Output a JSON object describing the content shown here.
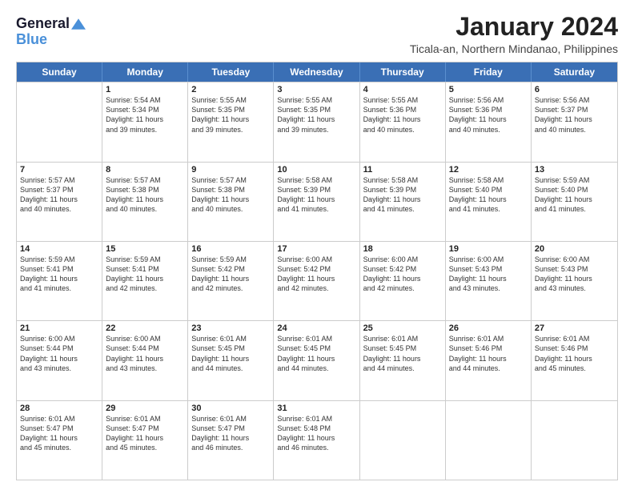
{
  "logo": {
    "line1": "General",
    "line2": "Blue"
  },
  "title": "January 2024",
  "subtitle": "Ticala-an, Northern Mindanao, Philippines",
  "header_days": [
    "Sunday",
    "Monday",
    "Tuesday",
    "Wednesday",
    "Thursday",
    "Friday",
    "Saturday"
  ],
  "weeks": [
    [
      {
        "day": "",
        "info": ""
      },
      {
        "day": "1",
        "info": "Sunrise: 5:54 AM\nSunset: 5:34 PM\nDaylight: 11 hours\nand 39 minutes."
      },
      {
        "day": "2",
        "info": "Sunrise: 5:55 AM\nSunset: 5:35 PM\nDaylight: 11 hours\nand 39 minutes."
      },
      {
        "day": "3",
        "info": "Sunrise: 5:55 AM\nSunset: 5:35 PM\nDaylight: 11 hours\nand 39 minutes."
      },
      {
        "day": "4",
        "info": "Sunrise: 5:55 AM\nSunset: 5:36 PM\nDaylight: 11 hours\nand 40 minutes."
      },
      {
        "day": "5",
        "info": "Sunrise: 5:56 AM\nSunset: 5:36 PM\nDaylight: 11 hours\nand 40 minutes."
      },
      {
        "day": "6",
        "info": "Sunrise: 5:56 AM\nSunset: 5:37 PM\nDaylight: 11 hours\nand 40 minutes."
      }
    ],
    [
      {
        "day": "7",
        "info": "Sunrise: 5:57 AM\nSunset: 5:37 PM\nDaylight: 11 hours\nand 40 minutes."
      },
      {
        "day": "8",
        "info": "Sunrise: 5:57 AM\nSunset: 5:38 PM\nDaylight: 11 hours\nand 40 minutes."
      },
      {
        "day": "9",
        "info": "Sunrise: 5:57 AM\nSunset: 5:38 PM\nDaylight: 11 hours\nand 40 minutes."
      },
      {
        "day": "10",
        "info": "Sunrise: 5:58 AM\nSunset: 5:39 PM\nDaylight: 11 hours\nand 41 minutes."
      },
      {
        "day": "11",
        "info": "Sunrise: 5:58 AM\nSunset: 5:39 PM\nDaylight: 11 hours\nand 41 minutes."
      },
      {
        "day": "12",
        "info": "Sunrise: 5:58 AM\nSunset: 5:40 PM\nDaylight: 11 hours\nand 41 minutes."
      },
      {
        "day": "13",
        "info": "Sunrise: 5:59 AM\nSunset: 5:40 PM\nDaylight: 11 hours\nand 41 minutes."
      }
    ],
    [
      {
        "day": "14",
        "info": "Sunrise: 5:59 AM\nSunset: 5:41 PM\nDaylight: 11 hours\nand 41 minutes."
      },
      {
        "day": "15",
        "info": "Sunrise: 5:59 AM\nSunset: 5:41 PM\nDaylight: 11 hours\nand 42 minutes."
      },
      {
        "day": "16",
        "info": "Sunrise: 5:59 AM\nSunset: 5:42 PM\nDaylight: 11 hours\nand 42 minutes."
      },
      {
        "day": "17",
        "info": "Sunrise: 6:00 AM\nSunset: 5:42 PM\nDaylight: 11 hours\nand 42 minutes."
      },
      {
        "day": "18",
        "info": "Sunrise: 6:00 AM\nSunset: 5:42 PM\nDaylight: 11 hours\nand 42 minutes."
      },
      {
        "day": "19",
        "info": "Sunrise: 6:00 AM\nSunset: 5:43 PM\nDaylight: 11 hours\nand 43 minutes."
      },
      {
        "day": "20",
        "info": "Sunrise: 6:00 AM\nSunset: 5:43 PM\nDaylight: 11 hours\nand 43 minutes."
      }
    ],
    [
      {
        "day": "21",
        "info": "Sunrise: 6:00 AM\nSunset: 5:44 PM\nDaylight: 11 hours\nand 43 minutes."
      },
      {
        "day": "22",
        "info": "Sunrise: 6:00 AM\nSunset: 5:44 PM\nDaylight: 11 hours\nand 43 minutes."
      },
      {
        "day": "23",
        "info": "Sunrise: 6:01 AM\nSunset: 5:45 PM\nDaylight: 11 hours\nand 44 minutes."
      },
      {
        "day": "24",
        "info": "Sunrise: 6:01 AM\nSunset: 5:45 PM\nDaylight: 11 hours\nand 44 minutes."
      },
      {
        "day": "25",
        "info": "Sunrise: 6:01 AM\nSunset: 5:45 PM\nDaylight: 11 hours\nand 44 minutes."
      },
      {
        "day": "26",
        "info": "Sunrise: 6:01 AM\nSunset: 5:46 PM\nDaylight: 11 hours\nand 44 minutes."
      },
      {
        "day": "27",
        "info": "Sunrise: 6:01 AM\nSunset: 5:46 PM\nDaylight: 11 hours\nand 45 minutes."
      }
    ],
    [
      {
        "day": "28",
        "info": "Sunrise: 6:01 AM\nSunset: 5:47 PM\nDaylight: 11 hours\nand 45 minutes."
      },
      {
        "day": "29",
        "info": "Sunrise: 6:01 AM\nSunset: 5:47 PM\nDaylight: 11 hours\nand 45 minutes."
      },
      {
        "day": "30",
        "info": "Sunrise: 6:01 AM\nSunset: 5:47 PM\nDaylight: 11 hours\nand 46 minutes."
      },
      {
        "day": "31",
        "info": "Sunrise: 6:01 AM\nSunset: 5:48 PM\nDaylight: 11 hours\nand 46 minutes."
      },
      {
        "day": "",
        "info": ""
      },
      {
        "day": "",
        "info": ""
      },
      {
        "day": "",
        "info": ""
      }
    ]
  ]
}
